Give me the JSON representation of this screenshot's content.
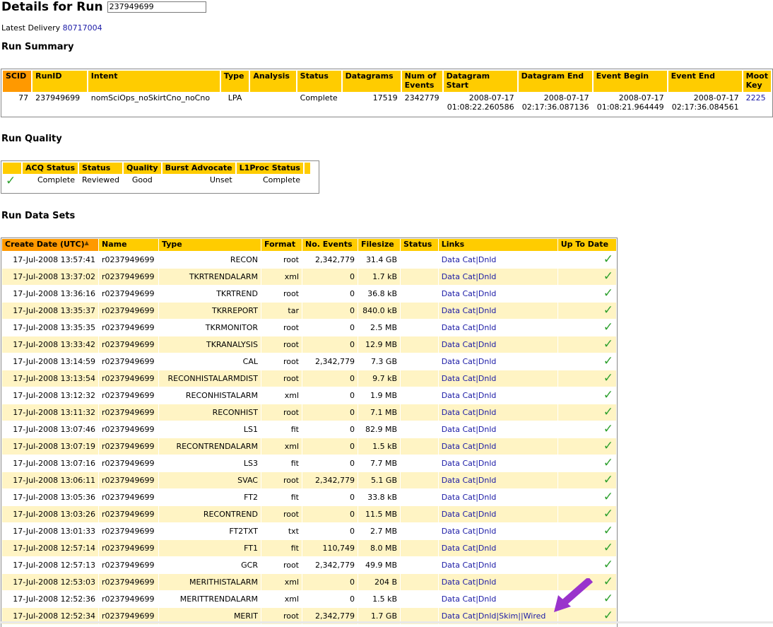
{
  "header": {
    "title": "Details for Run",
    "run_value": "237949699",
    "latest_label": "Latest Delivery",
    "latest_link": "80717004"
  },
  "sections": {
    "summary": "Run Summary",
    "quality": "Run Quality",
    "datasets": "Run Data Sets"
  },
  "summary": {
    "headers": [
      "SCID",
      "RunID",
      "Intent",
      "Type",
      "Analysis",
      "Status",
      "Datagrams",
      "Num of Events",
      "Datagram Start",
      "Datagram End",
      "Event Begin",
      "Event End",
      "Moot Key"
    ],
    "row": {
      "scid": "77",
      "runid": "237949699",
      "intent": "nomSciOps_noSkirtCno_noCno",
      "type": "LPA",
      "analysis": "",
      "status": "Complete",
      "datagrams": "17519",
      "num_events": "2342779",
      "dg_start_date": "2008-07-17",
      "dg_start_time": "01:08:22.260586",
      "dg_end_date": "2008-07-17",
      "dg_end_time": "02:17:36.087136",
      "ev_begin_date": "2008-07-17",
      "ev_begin_time": "01:08:21.964449",
      "ev_end_date": "2008-07-17",
      "ev_end_time": "02:17:36.084561",
      "moot_key": "2225"
    }
  },
  "quality": {
    "headers": [
      "",
      "ACQ Status",
      "Status",
      "Quality",
      "Burst Advocate",
      "L1Proc Status"
    ],
    "row": {
      "check": "check-icon",
      "acq": "Complete",
      "status": "Reviewed",
      "quality": "Good",
      "burst": "Unset",
      "l1proc": "Complete"
    }
  },
  "datasets": {
    "headers": {
      "create": "Create Date (UTC)",
      "name": "Name",
      "type": "Type",
      "format": "Format",
      "events": "No. Events",
      "filesize": "Filesize",
      "status": "Status",
      "links": "Links",
      "uptodate": "Up To Date"
    },
    "link_datacat": "Data Cat",
    "link_dnld": "Dnld",
    "link_skim": "Skim",
    "link_wired": "Wired",
    "rows": [
      {
        "date": "17-Jul-2008 13:57:41",
        "name": "r0237949699",
        "type": "RECON",
        "format": "root",
        "events": "2,342,779",
        "size": "31.4 GB"
      },
      {
        "date": "17-Jul-2008 13:37:02",
        "name": "r0237949699",
        "type": "TKRTRENDALARM",
        "format": "xml",
        "events": "0",
        "size": "1.7 kB"
      },
      {
        "date": "17-Jul-2008 13:36:16",
        "name": "r0237949699",
        "type": "TKRTREND",
        "format": "root",
        "events": "0",
        "size": "36.8 kB"
      },
      {
        "date": "17-Jul-2008 13:35:37",
        "name": "r0237949699",
        "type": "TKRREPORT",
        "format": "tar",
        "events": "0",
        "size": "840.0 kB"
      },
      {
        "date": "17-Jul-2008 13:35:35",
        "name": "r0237949699",
        "type": "TKRMONITOR",
        "format": "root",
        "events": "0",
        "size": "2.5 MB"
      },
      {
        "date": "17-Jul-2008 13:33:42",
        "name": "r0237949699",
        "type": "TKRANALYSIS",
        "format": "root",
        "events": "0",
        "size": "12.9 MB"
      },
      {
        "date": "17-Jul-2008 13:14:59",
        "name": "r0237949699",
        "type": "CAL",
        "format": "root",
        "events": "2,342,779",
        "size": "7.3 GB"
      },
      {
        "date": "17-Jul-2008 13:13:54",
        "name": "r0237949699",
        "type": "RECONHISTALARMDIST",
        "format": "root",
        "events": "0",
        "size": "9.7 kB"
      },
      {
        "date": "17-Jul-2008 13:12:32",
        "name": "r0237949699",
        "type": "RECONHISTALARM",
        "format": "xml",
        "events": "0",
        "size": "1.9 MB"
      },
      {
        "date": "17-Jul-2008 13:11:32",
        "name": "r0237949699",
        "type": "RECONHIST",
        "format": "root",
        "events": "0",
        "size": "7.1 MB"
      },
      {
        "date": "17-Jul-2008 13:07:46",
        "name": "r0237949699",
        "type": "LS1",
        "format": "fit",
        "events": "0",
        "size": "82.9 MB"
      },
      {
        "date": "17-Jul-2008 13:07:19",
        "name": "r0237949699",
        "type": "RECONTRENDALARM",
        "format": "xml",
        "events": "0",
        "size": "1.5 kB"
      },
      {
        "date": "17-Jul-2008 13:07:16",
        "name": "r0237949699",
        "type": "LS3",
        "format": "fit",
        "events": "0",
        "size": "7.7 MB"
      },
      {
        "date": "17-Jul-2008 13:06:11",
        "name": "r0237949699",
        "type": "SVAC",
        "format": "root",
        "events": "2,342,779",
        "size": "5.1 GB"
      },
      {
        "date": "17-Jul-2008 13:05:36",
        "name": "r0237949699",
        "type": "FT2",
        "format": "fit",
        "events": "0",
        "size": "33.8 kB"
      },
      {
        "date": "17-Jul-2008 13:03:26",
        "name": "r0237949699",
        "type": "RECONTREND",
        "format": "root",
        "events": "0",
        "size": "11.5 MB"
      },
      {
        "date": "17-Jul-2008 13:01:33",
        "name": "r0237949699",
        "type": "FT2TXT",
        "format": "txt",
        "events": "0",
        "size": "2.7 MB"
      },
      {
        "date": "17-Jul-2008 12:57:14",
        "name": "r0237949699",
        "type": "FT1",
        "format": "fit",
        "events": "110,749",
        "size": "8.0 MB"
      },
      {
        "date": "17-Jul-2008 12:57:13",
        "name": "r0237949699",
        "type": "GCR",
        "format": "root",
        "events": "2,342,779",
        "size": "49.9 MB"
      },
      {
        "date": "17-Jul-2008 12:53:03",
        "name": "r0237949699",
        "type": "MERITHISTALARM",
        "format": "xml",
        "events": "0",
        "size": "204 B"
      },
      {
        "date": "17-Jul-2008 12:52:36",
        "name": "r0237949699",
        "type": "MERITTRENDALARM",
        "format": "xml",
        "events": "0",
        "size": "1.5 kB"
      },
      {
        "date": "17-Jul-2008 12:52:34",
        "name": "r0237949699",
        "type": "MERIT",
        "format": "root",
        "events": "2,342,779",
        "size": "1.7 GB",
        "extra": true
      }
    ]
  },
  "annotation": {
    "arrow_color": "#9933cc",
    "icon": "pointer-arrow-icon"
  },
  "colors": {
    "header_bg": "#ffcc00",
    "sorted_header_bg": "#ff9900",
    "alt_row_bg": "#fff4c4",
    "link": "#1a1aa6",
    "check": "#2ea02e"
  }
}
